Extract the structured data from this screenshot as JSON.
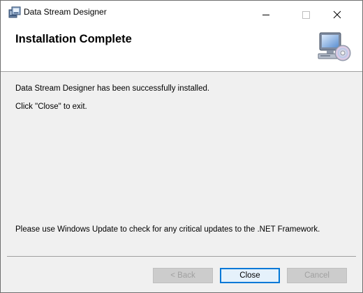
{
  "window": {
    "title": "Data Stream Designer",
    "app_icon": "installer-icon"
  },
  "titlebar_buttons": {
    "minimize": "minimize-icon",
    "maximize": "maximize-icon",
    "close": "close-icon"
  },
  "banner": {
    "title": "Installation Complete",
    "icon": "computer-cd-icon"
  },
  "body": {
    "line1": "Data Stream Designer has been successfully installed.",
    "line2": "Click \"Close\" to exit.",
    "line3": "Please use Windows Update to check for any critical updates to the .NET Framework."
  },
  "buttons": {
    "back": "< Back",
    "close": "Close",
    "cancel": "Cancel"
  },
  "colors": {
    "focus_border": "#0078d7",
    "disabled_text": "#a0a0a0",
    "dialog_background": "#f0f0f0"
  }
}
